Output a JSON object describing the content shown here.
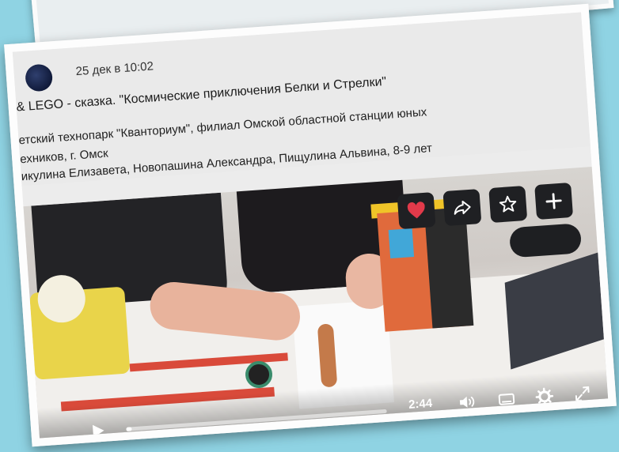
{
  "post": {
    "date": "25 дек в 10:02",
    "title": "& LEGO - сказка. \"Космические приключения Белки и Стрелки\"",
    "org_line1": "етский технопарк \"Кванториум\", филиал Омской областной станции юных",
    "org_line2": "ехников, г. Омск",
    "authors": "икулина Елизавета, Новопашина Александра, Пищулина Альвина, 8-9 лет"
  },
  "video": {
    "time": "2:44",
    "progress": 0.02
  },
  "actions": [
    {
      "name": "like-button",
      "icon": "heart-icon"
    },
    {
      "name": "share-button",
      "icon": "share-arrow-icon"
    },
    {
      "name": "favorite-button",
      "icon": "star-icon"
    },
    {
      "name": "add-button",
      "icon": "plus-icon"
    }
  ],
  "controls": {
    "icons": [
      "play-icon",
      "volume-icon",
      "miniplayer-icon",
      "settings-gear-icon",
      "fullscreen-icon"
    ]
  },
  "colors": {
    "accent_heart": "#e23a4a",
    "button_bg": "#1f2023",
    "frame": "#fdfdfd",
    "background": "#8fd3e3"
  }
}
